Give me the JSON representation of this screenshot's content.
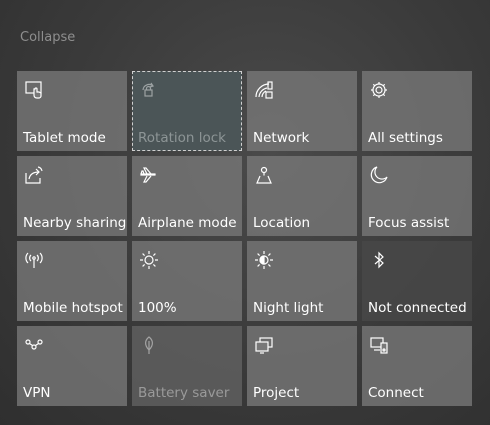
{
  "header": {
    "collapse_label": "Collapse"
  },
  "tiles": {
    "tablet_mode": "Tablet mode",
    "rotation_lock": "Rotation lock",
    "network": "Network",
    "all_settings": "All settings",
    "nearby_sharing": "Nearby sharing",
    "airplane_mode": "Airplane mode",
    "location": "Location",
    "focus_assist": "Focus assist",
    "mobile_hotspot": "Mobile hotspot",
    "brightness": "100%",
    "night_light": "Night light",
    "bluetooth": "Not connected",
    "vpn": "VPN",
    "battery_saver": "Battery saver",
    "project": "Project",
    "connect": "Connect"
  },
  "colors": {
    "tile": "#787878",
    "focused_tile": "#4b5557",
    "disabled_text": "#9a9a9a"
  }
}
